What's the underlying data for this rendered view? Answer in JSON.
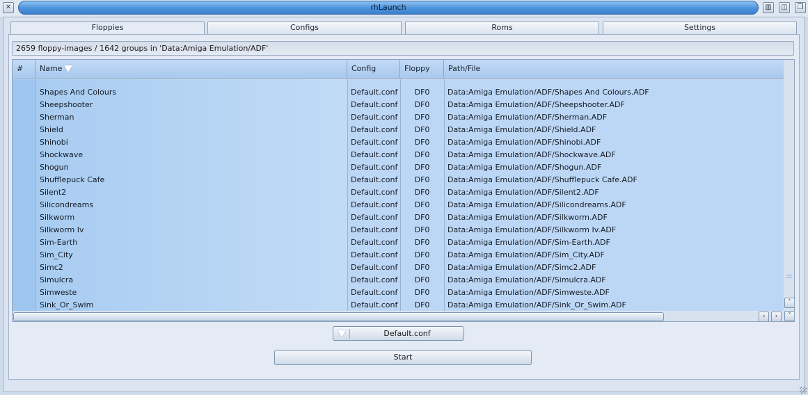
{
  "window": {
    "title": "rhLaunch"
  },
  "tabs": [
    {
      "label": "Floppies",
      "active": true
    },
    {
      "label": "Configs",
      "active": false
    },
    {
      "label": "Roms",
      "active": false
    },
    {
      "label": "Settings",
      "active": false
    }
  ],
  "info": "2659 floppy-images / 1642 groups in 'Data:Amiga Emulation/ADF'",
  "list": {
    "columns": {
      "hash": "#",
      "name": "Name",
      "config": "Config",
      "floppy": "Floppy",
      "path": "Path/File"
    },
    "sort": {
      "column": "name",
      "icon": "triangle-down-icon"
    },
    "rows": [
      {
        "name": "Shapes And Colours",
        "config": "Default.conf",
        "floppy": "DF0",
        "path": "Data:Amiga Emulation/ADF/Shapes And Colours.ADF"
      },
      {
        "name": "Sheepshooter",
        "config": "Default.conf",
        "floppy": "DF0",
        "path": "Data:Amiga Emulation/ADF/Sheepshooter.ADF"
      },
      {
        "name": "Sherman",
        "config": "Default.conf",
        "floppy": "DF0",
        "path": "Data:Amiga Emulation/ADF/Sherman.ADF"
      },
      {
        "name": "Shield",
        "config": "Default.conf",
        "floppy": "DF0",
        "path": "Data:Amiga Emulation/ADF/Shield.ADF"
      },
      {
        "name": "Shinobi",
        "config": "Default.conf",
        "floppy": "DF0",
        "path": "Data:Amiga Emulation/ADF/Shinobi.ADF"
      },
      {
        "name": "Shockwave",
        "config": "Default.conf",
        "floppy": "DF0",
        "path": "Data:Amiga Emulation/ADF/Shockwave.ADF"
      },
      {
        "name": "Shogun",
        "config": "Default.conf",
        "floppy": "DF0",
        "path": "Data:Amiga Emulation/ADF/Shogun.ADF"
      },
      {
        "name": "Shufflepuck Cafe",
        "config": "Default.conf",
        "floppy": "DF0",
        "path": "Data:Amiga Emulation/ADF/Shufflepuck Cafe.ADF"
      },
      {
        "name": "Silent2",
        "config": "Default.conf",
        "floppy": "DF0",
        "path": "Data:Amiga Emulation/ADF/Silent2.ADF"
      },
      {
        "name": "Silicondreams",
        "config": "Default.conf",
        "floppy": "DF0",
        "path": "Data:Amiga Emulation/ADF/Silicondreams.ADF"
      },
      {
        "name": "Silkworm",
        "config": "Default.conf",
        "floppy": "DF0",
        "path": "Data:Amiga Emulation/ADF/Silkworm.ADF"
      },
      {
        "name": "Silkworm Iv",
        "config": "Default.conf",
        "floppy": "DF0",
        "path": "Data:Amiga Emulation/ADF/Silkworm Iv.ADF"
      },
      {
        "name": "Sim-Earth",
        "config": "Default.conf",
        "floppy": "DF0",
        "path": "Data:Amiga Emulation/ADF/Sim-Earth.ADF"
      },
      {
        "name": "Sim_City",
        "config": "Default.conf",
        "floppy": "DF0",
        "path": "Data:Amiga Emulation/ADF/Sim_City.ADF"
      },
      {
        "name": "Simc2",
        "config": "Default.conf",
        "floppy": "DF0",
        "path": "Data:Amiga Emulation/ADF/Simc2.ADF"
      },
      {
        "name": "Simulcra",
        "config": "Default.conf",
        "floppy": "DF0",
        "path": "Data:Amiga Emulation/ADF/Simulcra.ADF"
      },
      {
        "name": "Simweste",
        "config": "Default.conf",
        "floppy": "DF0",
        "path": "Data:Amiga Emulation/ADF/Simweste.ADF"
      },
      {
        "name": "Sink_Or_Swim",
        "config": "Default.conf",
        "floppy": "DF0",
        "path": "Data:Amiga Emulation/ADF/Sink_Or_Swim.ADF"
      }
    ]
  },
  "config_cycle": {
    "value": "Default.conf",
    "icon": "triangle-down-icon"
  },
  "start_label": "Start",
  "icons": {
    "close": "close-icon",
    "iconify": "iconify-icon",
    "zoom": "zoom-icon",
    "depth": "depth-icon",
    "scroll_up": "arrow-up-icon",
    "scroll_down": "arrow-down-icon",
    "scroll_left": "arrow-left-icon",
    "scroll_right": "arrow-right-icon",
    "resize": "resize-grip-icon"
  }
}
